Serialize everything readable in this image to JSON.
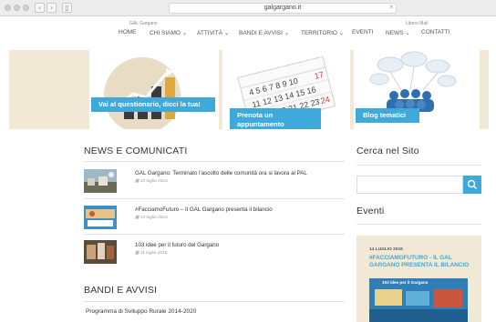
{
  "browser": {
    "url": "galgargano.it",
    "close_glyph": "×",
    "back_glyph": "‹",
    "forward_glyph": "›",
    "sidebar_glyph": "▯"
  },
  "header": {
    "left_tagline": "GAL Gargano",
    "right_tagline": "Libero Mail"
  },
  "nav": {
    "items": [
      {
        "label": "HOME"
      },
      {
        "label": "CHI SIAMO ⌄"
      },
      {
        "label": "ATTIVITÀ ⌄"
      },
      {
        "label": "BANDI E AVVISI ⌄"
      },
      {
        "label": "TERRITORIO ⌄"
      },
      {
        "label": "EVENTI"
      },
      {
        "label": "NEWS ⌄"
      },
      {
        "label": "CONTATTI"
      }
    ]
  },
  "banner": {
    "panels": [
      {
        "caption": "Vai al questionario, dicci la tua!",
        "icon": "chart-growth-icon"
      },
      {
        "caption": "Prenota un appuntamento",
        "icon": "calendar-icon"
      },
      {
        "caption": "Blog tematici",
        "icon": "people-network-icon"
      }
    ]
  },
  "news": {
    "title": "NEWS E COMUNICATI",
    "date_icon": "calendar-small-icon",
    "items": [
      {
        "title": "GAL Gargano: Terminato l'ascolto delle comunità ora si lavora al PAL",
        "date": "22 luglio 2016"
      },
      {
        "title": "#FacciamoFuturo – Il GAL Gargano presenta il bilancio",
        "date": "14 luglio 2016"
      },
      {
        "title": "103 idee per il futuro del Gargano",
        "date": "11 luglio 2016"
      }
    ]
  },
  "bandi": {
    "title": "BANDI E AVVISI",
    "items": [
      {
        "title": "Programma di Sviluppo Rurale 2014-2020"
      }
    ]
  },
  "sidebar": {
    "search_title": "Cerca nel Sito",
    "search_placeholder": "",
    "search_icon": "search-icon",
    "events_title": "Eventi",
    "event": {
      "date": "14 LUGLIO 2016",
      "title": "#FACCIAMOFUTURO - IL GAL GARGANO PRESENTA IL BILANCIO",
      "image_caption": "103 idee per il Gargano"
    }
  },
  "colors": {
    "accent": "#3fa9dc",
    "banner_bg": "#f1e8d6",
    "text": "#333333"
  }
}
